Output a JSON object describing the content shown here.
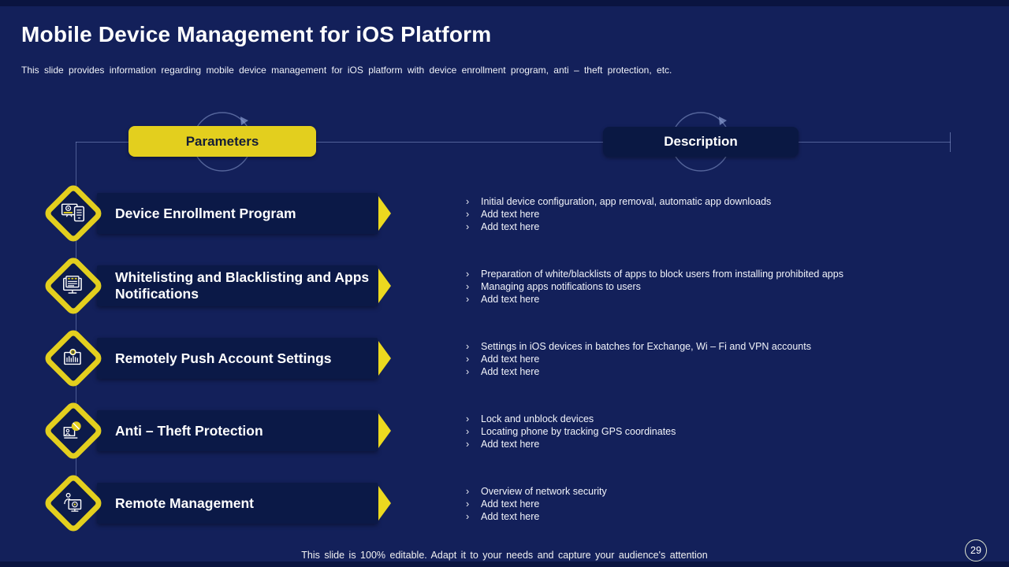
{
  "bullet_marker": "›",
  "slide": {
    "title": "Mobile Device Management for iOS Platform",
    "subtitle": "This slide provides information regarding mobile device management for iOS platform with device enrollment program, anti – theft protection, etc.",
    "footer": "This slide is 100% editable. Adapt it to your needs and capture your audience's attention",
    "page_number": "29"
  },
  "headers": {
    "parameters_label": "Parameters",
    "description_label": "Description"
  },
  "colors": {
    "background": "#13205a",
    "panel": "#0b1947",
    "accent_yellow": "#e3cf1e",
    "text": "#ffffff",
    "connector_line": "#8798cd"
  },
  "rows": [
    {
      "icon": "device-enrollment-icon",
      "title": "Device Enrollment Program",
      "bullets": [
        "Initial device configuration, app removal, automatic app downloads",
        "Add text here",
        "Add text here"
      ]
    },
    {
      "icon": "whitelist-blacklist-icon",
      "title": "Whitelisting and Blacklisting and Apps Notifications",
      "bullets": [
        "Preparation of white/blacklists of apps to block users from installing prohibited apps",
        "Managing apps notifications to users",
        "Add text here"
      ]
    },
    {
      "icon": "push-settings-icon",
      "title": "Remotely Push Account Settings",
      "bullets": [
        "Settings in iOS devices in batches for Exchange, Wi – Fi and VPN accounts",
        "Add text here",
        "Add text here"
      ]
    },
    {
      "icon": "anti-theft-icon",
      "title": "Anti – Theft Protection",
      "bullets": [
        "Lock and unblock devices",
        "Locating phone by tracking GPS coordinates",
        "Add text here"
      ]
    },
    {
      "icon": "remote-management-icon",
      "title": "Remote Management",
      "bullets": [
        "Overview of network security",
        "Add text here",
        "Add text here"
      ]
    }
  ]
}
